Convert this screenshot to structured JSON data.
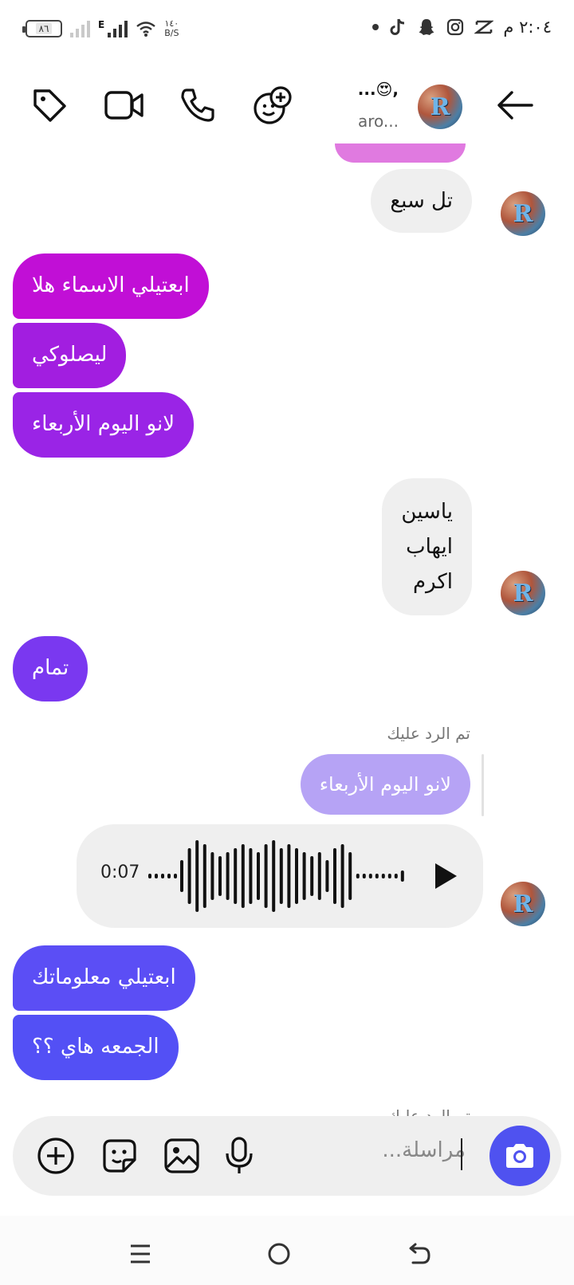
{
  "status_bar": {
    "time": "٢:٠٤ م",
    "battery_level": "٨٦",
    "network_type": "E",
    "speed_value": "١٤٠",
    "speed_unit": "B/S"
  },
  "header": {
    "name": "...😍,",
    "subtitle": "aro..."
  },
  "avatar_letter": "R",
  "messages": {
    "m1": "تل سبع",
    "m2": "ابعتيلي الاسماء هلا",
    "m3": "ليصلوكي",
    "m4": "لانو اليوم الأربعاء",
    "m5_lines": [
      "ياسين",
      "ايهاب",
      "اكرم"
    ],
    "m6": "تمام",
    "reply_label": "تم الرد عليك",
    "reply_quote": "لانو اليوم الأربعاء",
    "voice_duration": "0:07",
    "m7": "ابعتيلي معلوماتك",
    "m8": "الجمعه هاي ؟؟",
    "reply_label_2": "تم الرد عليك"
  },
  "composer": {
    "placeholder": "مراسلة..."
  },
  "colors": {
    "sent_1": "#c10fd6",
    "sent_2": "#a21ee0",
    "sent_3": "#9a24e6",
    "sent_4": "#7a38f0",
    "sent_5": "#5b4ef5",
    "sent_6": "#5350f5",
    "received": "#efefef",
    "reply_quote": "#b6a3f5",
    "camera": "#4f52f0"
  }
}
